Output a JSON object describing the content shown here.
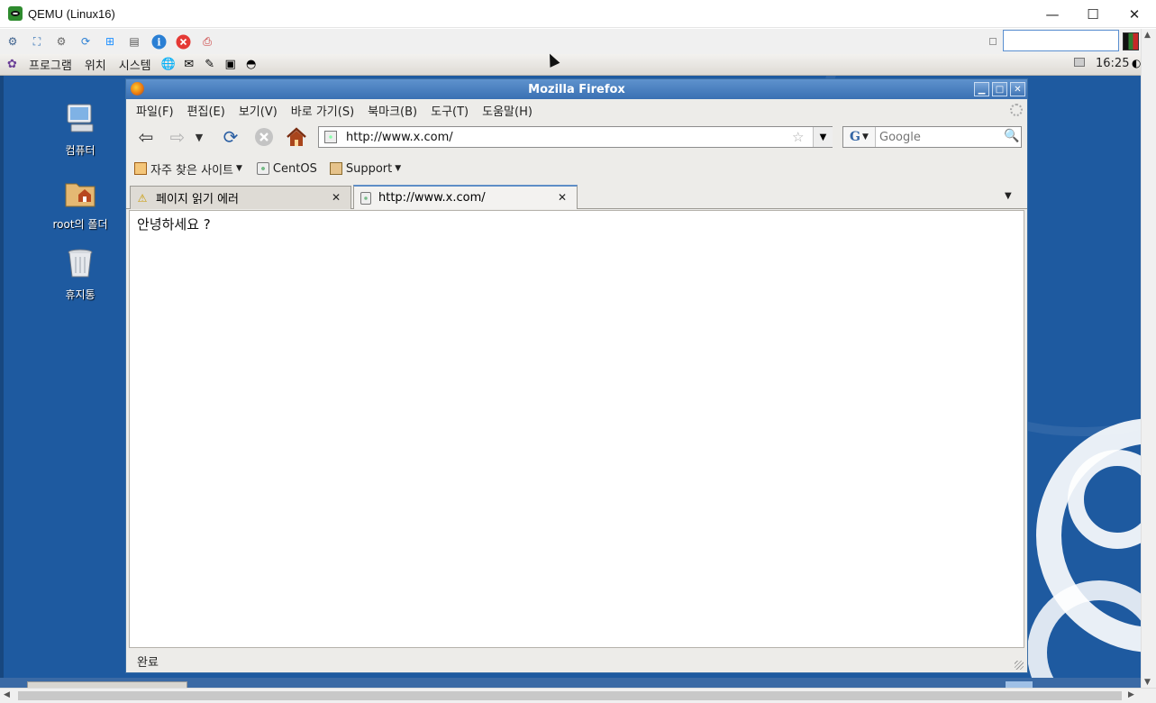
{
  "host_window": {
    "title": "QEMU (Linux16)",
    "controls": {
      "minimize": "—",
      "maximize": "☐",
      "close": "✕"
    }
  },
  "qemu_toolbar": {
    "icons": [
      "network-icon",
      "fullscreen-icon",
      "settings-icon",
      "refresh-icon",
      "windows-icon",
      "disk-icon",
      "info-icon",
      "stop-icon",
      "screenshot-icon"
    ]
  },
  "gnome_panel": {
    "menus": [
      "프로그램",
      "위치",
      "시스템"
    ],
    "clock": "16:25"
  },
  "desktop": {
    "icons": [
      {
        "label": "컴퓨터",
        "icon": "computer-icon"
      },
      {
        "label": "root의 폴더",
        "icon": "home-folder-icon"
      },
      {
        "label": "휴지통",
        "icon": "trash-icon"
      }
    ],
    "colors": {
      "background": "#1e5aa0"
    }
  },
  "firefox": {
    "title": "Mozilla Firefox",
    "menu": [
      "파일(F)",
      "편집(E)",
      "보기(V)",
      "바로 가기(S)",
      "북마크(B)",
      "도구(T)",
      "도움말(H)"
    ],
    "url": "http://www.x.com/",
    "search_placeholder": "Google",
    "search_engine": "G",
    "bookmarks": {
      "frequent": "자주 찾은 사이트",
      "centos": "CentOS",
      "support": "Support"
    },
    "tabs": [
      {
        "label": "페이지 읽기 에러",
        "active": false,
        "icon": "warning-icon"
      },
      {
        "label": "http://www.x.com/",
        "active": true,
        "icon": "page-icon"
      }
    ],
    "content_text": "안녕하세요 ?",
    "status": "완료",
    "colors": {
      "titlebar": "#3a70b3",
      "chrome": "#edece9"
    }
  }
}
